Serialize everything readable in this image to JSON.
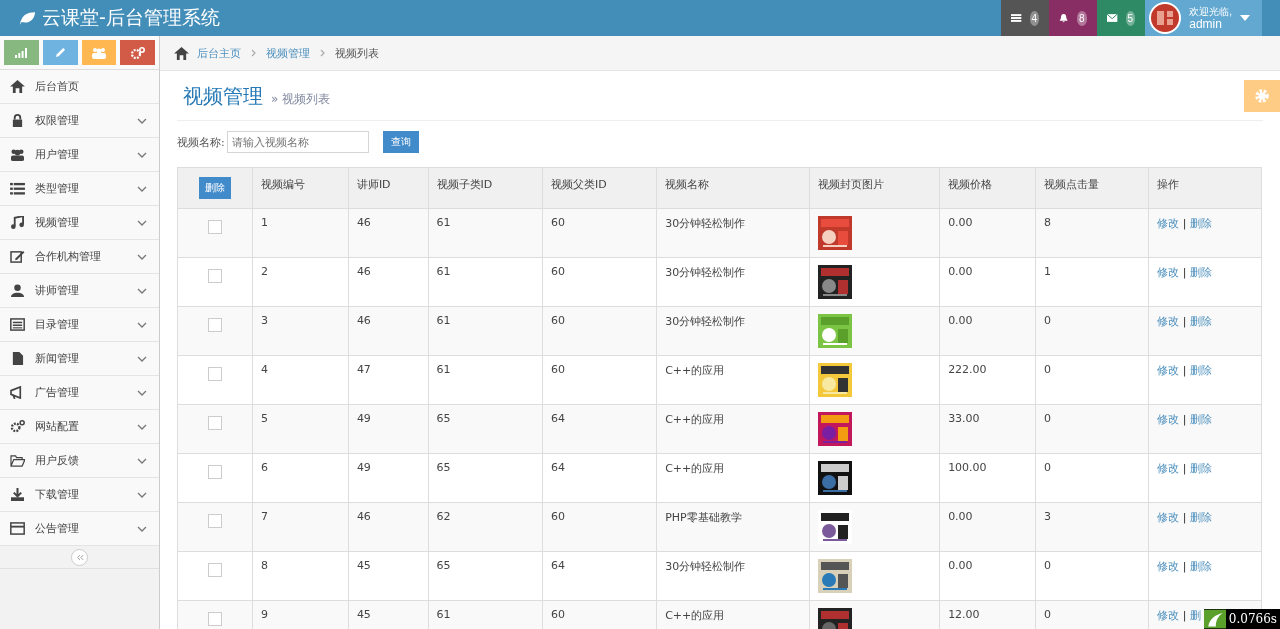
{
  "header": {
    "title": "云课堂-后台管理系统",
    "notifications": [
      {
        "count": "4",
        "color": "#555555"
      },
      {
        "count": "8",
        "color": "#892e65"
      },
      {
        "count": "5",
        "color": "#2e8965"
      }
    ],
    "user": {
      "greeting": "欢迎光临,",
      "name": "admin"
    }
  },
  "sidebar": {
    "items": [
      {
        "label": "后台首页",
        "expandable": false
      },
      {
        "label": "权限管理",
        "expandable": true
      },
      {
        "label": "用户管理",
        "expandable": true
      },
      {
        "label": "类型管理",
        "expandable": true
      },
      {
        "label": "视频管理",
        "expandable": true
      },
      {
        "label": "合作机构管理",
        "expandable": true
      },
      {
        "label": "讲师管理",
        "expandable": true
      },
      {
        "label": "目录管理",
        "expandable": true
      },
      {
        "label": "新闻管理",
        "expandable": true
      },
      {
        "label": "广告管理",
        "expandable": true
      },
      {
        "label": "网站配置",
        "expandable": true
      },
      {
        "label": "用户反馈",
        "expandable": true
      },
      {
        "label": "下载管理",
        "expandable": true
      },
      {
        "label": "公告管理",
        "expandable": true
      }
    ]
  },
  "breadcrumb": [
    "后台主页",
    "视频管理",
    "视频列表"
  ],
  "page": {
    "title": "视频管理",
    "subtitle": "» 视频列表"
  },
  "search": {
    "label": "视频名称:",
    "placeholder": "请输入视频名称",
    "button": "查询"
  },
  "table": {
    "delete_button": "删除",
    "columns": [
      "视频编号",
      "讲师ID",
      "视频子类ID",
      "视频父类ID",
      "视频名称",
      "视频封页图片",
      "视频价格",
      "视频点击量",
      "操作"
    ],
    "rows": [
      {
        "checked": false,
        "cells": [
          "1",
          "46",
          "61",
          "60",
          "30分钟轻松制作"
        ],
        "price": "0.00",
        "clicks": "8",
        "edit": "修改",
        "sep": "|",
        "delete": "删除"
      },
      {
        "checked": false,
        "cells": [
          "2",
          "46",
          "61",
          "60",
          "30分钟轻松制作"
        ],
        "price": "0.00",
        "clicks": "1",
        "edit": "修改",
        "sep": "|",
        "delete": "删除"
      },
      {
        "checked": false,
        "cells": [
          "3",
          "46",
          "61",
          "60",
          "30分钟轻松制作"
        ],
        "price": "0.00",
        "clicks": "0",
        "edit": "修改",
        "sep": "|",
        "delete": "删除"
      },
      {
        "checked": false,
        "cells": [
          "4",
          "47",
          "61",
          "60",
          "C++的应用"
        ],
        "price": "222.00",
        "clicks": "0",
        "edit": "修改",
        "sep": "|",
        "delete": "删除"
      },
      {
        "checked": false,
        "cells": [
          "5",
          "49",
          "65",
          "64",
          "C++的应用"
        ],
        "price": "33.00",
        "clicks": "0",
        "edit": "修改",
        "sep": "|",
        "delete": "删除"
      },
      {
        "checked": false,
        "cells": [
          "6",
          "49",
          "65",
          "64",
          "C++的应用"
        ],
        "price": "100.00",
        "clicks": "0",
        "edit": "修改",
        "sep": "|",
        "delete": "删除"
      },
      {
        "checked": false,
        "cells": [
          "7",
          "46",
          "62",
          "60",
          "PHP零基础教学"
        ],
        "price": "0.00",
        "clicks": "3",
        "edit": "修改",
        "sep": "|",
        "delete": "删除"
      },
      {
        "checked": false,
        "cells": [
          "8",
          "45",
          "65",
          "64",
          "30分钟轻松制作"
        ],
        "price": "0.00",
        "clicks": "0",
        "edit": "修改",
        "sep": "|",
        "delete": "删除"
      },
      {
        "checked": false,
        "cells": [
          "9",
          "45",
          "61",
          "60",
          "C++的应用"
        ],
        "price": "12.00",
        "clicks": "0",
        "edit": "修改",
        "sep": "|",
        "delete": "删"
      }
    ]
  },
  "timer": "0.0766s"
}
